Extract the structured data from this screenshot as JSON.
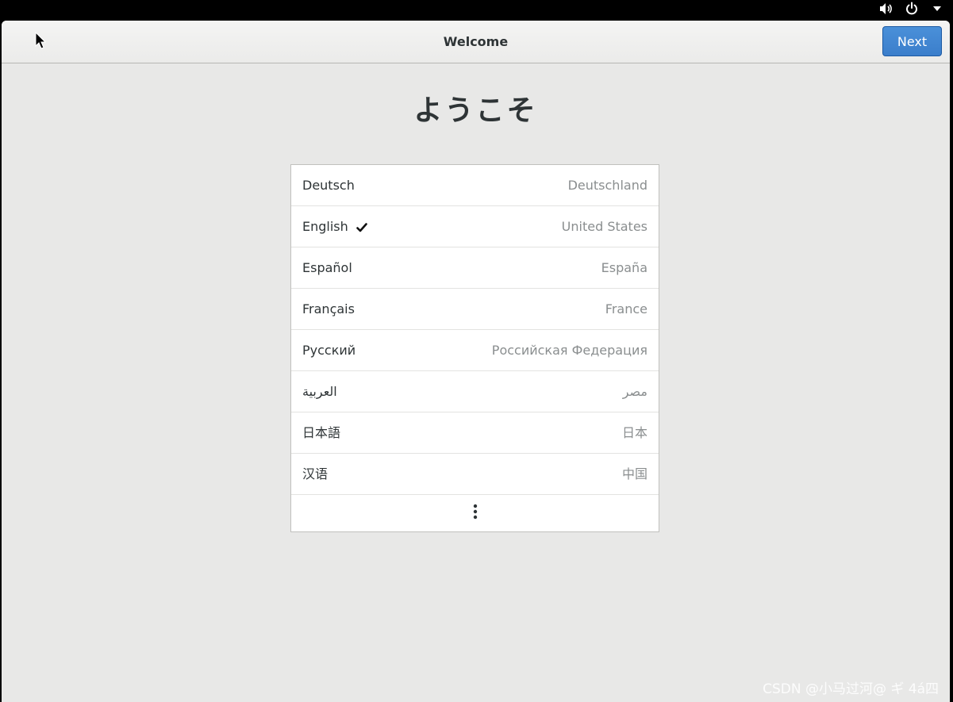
{
  "window": {
    "title": "Welcome",
    "next_label": "Next"
  },
  "heading": "ようこそ",
  "languages": [
    {
      "name": "Deutsch",
      "region": "Deutschland",
      "selected": false
    },
    {
      "name": "English",
      "region": "United States",
      "selected": true
    },
    {
      "name": "Español",
      "region": "España",
      "selected": false
    },
    {
      "name": "Français",
      "region": "France",
      "selected": false
    },
    {
      "name": "Русский",
      "region": "Российская Федерация",
      "selected": false
    },
    {
      "name": "العربية",
      "region": "مصر",
      "selected": false
    },
    {
      "name": "日本語",
      "region": "日本",
      "selected": false
    },
    {
      "name": "汉语",
      "region": "中国",
      "selected": false
    }
  ],
  "icons": {
    "volume": "speaker-volume-icon",
    "power": "power-icon",
    "menu": "chevron-down-icon",
    "selected": "checkmark-icon",
    "more": "more-vertical-icon"
  },
  "watermark": "CSDN @小马过河@ ギ 4á四",
  "colors": {
    "accent": "#4a90d9",
    "window_bg": "#e8e8e7",
    "topbar_bg": "#000000"
  }
}
